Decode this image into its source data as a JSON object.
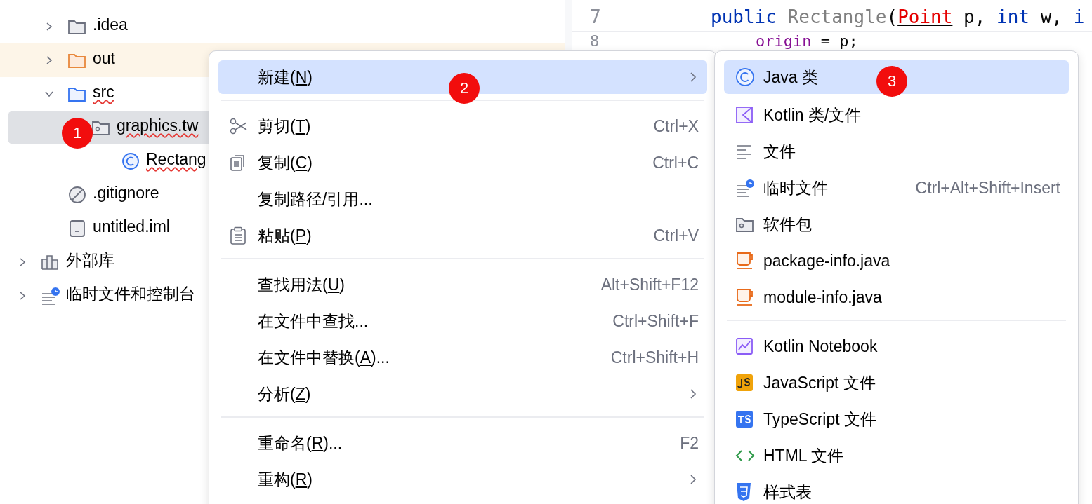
{
  "project_tree": [
    {
      "children": [
        {
          "label": ".idea",
          "kind": "folder",
          "expanded": false,
          "selected": false
        },
        {
          "label": "out",
          "kind": "excluded",
          "expanded": false,
          "selected": false
        },
        {
          "label": "src",
          "kind": "source",
          "expanded": true,
          "selected": false,
          "error": true,
          "children": [
            {
              "label": "graphics.tw",
              "kind": "package",
              "selected": true,
              "error": true,
              "children": [
                {
                  "label": "Rectang",
                  "kind": "class",
                  "selected": false,
                  "error": true
                }
              ]
            }
          ]
        },
        {
          "label": ".gitignore",
          "kind": "ignore",
          "selected": false
        },
        {
          "label": "untitled.iml",
          "kind": "module",
          "selected": false
        }
      ]
    },
    {
      "label": "外部库",
      "kind": "library",
      "expanded": false,
      "selected": false
    },
    {
      "label": "临时文件和控制台",
      "kind": "scratch",
      "expanded": false,
      "selected": false
    }
  ],
  "editor": {
    "lines": [
      {
        "number": "7",
        "tokens": [
          {
            "text": "public ",
            "kind": "keyword"
          },
          {
            "text": "Rectangle",
            "kind": "muted"
          },
          {
            "text": "(",
            "kind": "plain"
          },
          {
            "text": "Point",
            "kind": "error"
          },
          {
            "text": " p, ",
            "kind": "plain"
          },
          {
            "text": "int",
            "kind": "keyword"
          },
          {
            "text": " w, ",
            "kind": "plain"
          },
          {
            "text": "i",
            "kind": "keyword"
          }
        ]
      },
      {
        "number": "8",
        "tokens": [
          {
            "text": "origin",
            "kind": "field"
          },
          {
            "text": " = p;",
            "kind": "plain"
          }
        ]
      }
    ]
  },
  "context_menu": [
    {
      "kind": "item",
      "label": "新建(",
      "mnemonic": "N",
      "label_end": ")",
      "submenu": true,
      "selected": true
    },
    {
      "kind": "separator"
    },
    {
      "kind": "item",
      "label": "剪切(",
      "mnemonic": "T",
      "label_end": ")",
      "shortcut": "Ctrl+X",
      "submenu": false,
      "selected": false
    },
    {
      "kind": "item",
      "label": "复制(",
      "mnemonic": "C",
      "label_end": ")",
      "shortcut": "Ctrl+C",
      "submenu": false,
      "selected": false
    },
    {
      "kind": "item",
      "label": "复制路径/引用...",
      "submenu": false,
      "selected": false
    },
    {
      "kind": "item",
      "label": "粘贴(",
      "mnemonic": "P",
      "label_end": ")",
      "shortcut": "Ctrl+V",
      "submenu": false,
      "selected": false
    },
    {
      "kind": "separator"
    },
    {
      "kind": "item",
      "label": "查找用法(",
      "mnemonic": "U",
      "label_end": ")",
      "shortcut": "Alt+Shift+F12",
      "submenu": false,
      "selected": false
    },
    {
      "kind": "item",
      "label": "在文件中查找...",
      "shortcut": "Ctrl+Shift+F",
      "submenu": false,
      "selected": false
    },
    {
      "kind": "item",
      "label": "在文件中替换(",
      "mnemonic": "A",
      "label_end": ")...",
      "shortcut": "Ctrl+Shift+H",
      "submenu": false,
      "selected": false
    },
    {
      "kind": "item",
      "label": "分析(",
      "mnemonic": "Z",
      "label_end": ")",
      "submenu": true,
      "selected": false
    },
    {
      "kind": "separator"
    },
    {
      "kind": "item",
      "label": "重命名(",
      "mnemonic": "R",
      "label_end": ")...",
      "shortcut": "F2",
      "submenu": false,
      "selected": false
    },
    {
      "kind": "item",
      "label": "重构(",
      "mnemonic": "R",
      "label_end": ")",
      "submenu": true,
      "selected": false
    }
  ],
  "new_submenu": [
    {
      "kind": "item",
      "label": "Java 类",
      "submenu": false,
      "selected": true
    },
    {
      "kind": "item",
      "label": "Kotlin 类/文件",
      "submenu": false,
      "selected": false
    },
    {
      "kind": "item",
      "label": "文件",
      "submenu": false,
      "selected": false
    },
    {
      "kind": "item",
      "label": "临时文件",
      "shortcut": "Ctrl+Alt+Shift+Insert",
      "submenu": false,
      "selected": false
    },
    {
      "kind": "item",
      "label": "软件包",
      "submenu": false,
      "selected": false
    },
    {
      "kind": "item",
      "label": "package-info.java",
      "submenu": false,
      "selected": false
    },
    {
      "kind": "item",
      "label": "module-info.java",
      "submenu": false,
      "selected": false
    },
    {
      "kind": "separator"
    },
    {
      "kind": "item",
      "label": "Kotlin Notebook",
      "submenu": false,
      "selected": false
    },
    {
      "kind": "item",
      "label": "JavaScript 文件",
      "submenu": false,
      "selected": false
    },
    {
      "kind": "item",
      "label": "TypeScript 文件",
      "submenu": false,
      "selected": false
    },
    {
      "kind": "item",
      "label": "HTML 文件",
      "submenu": false,
      "selected": false
    },
    {
      "kind": "item",
      "label": "样式表",
      "submenu": false,
      "selected": false
    }
  ],
  "step_markers": [
    {
      "label": "1"
    },
    {
      "label": "2"
    },
    {
      "label": "3"
    }
  ]
}
